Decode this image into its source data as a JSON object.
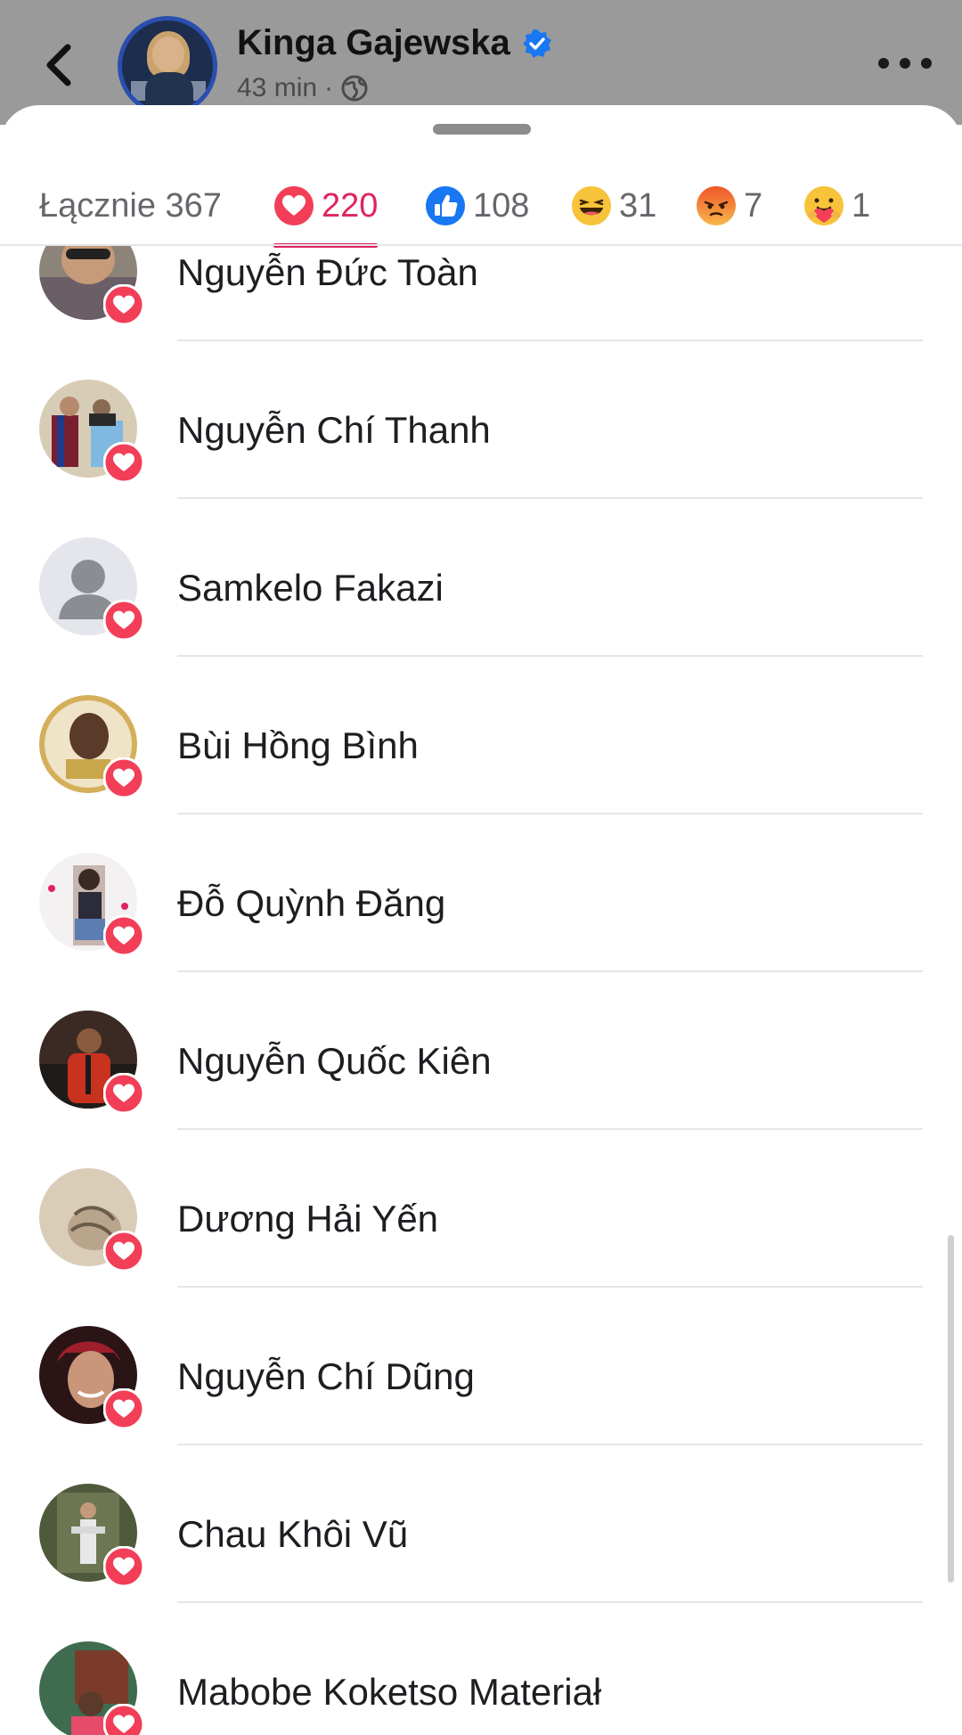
{
  "header": {
    "page_name": "Kinga Gajewska",
    "time": "43 min",
    "separator": "·",
    "icons": {
      "back": "back-chevron-icon",
      "verified": "verified-badge-icon",
      "privacy": "globe-icon",
      "more": "more-dots-icon"
    },
    "colors": {
      "verified": "#1877f2"
    }
  },
  "reaction_tabs": [
    {
      "label": "Łącznie 367",
      "icon": null
    },
    {
      "label": "220",
      "icon": "love-reaction-icon",
      "active": true
    },
    {
      "label": "108",
      "icon": "like-reaction-icon"
    },
    {
      "label": "31",
      "icon": "haha-reaction-icon"
    },
    {
      "label": "7",
      "icon": "angry-reaction-icon"
    },
    {
      "label": "1",
      "icon": "care-reaction-icon"
    }
  ],
  "reactors": [
    {
      "name": "Nguyễn Đức Toàn"
    },
    {
      "name": "Nguyễn Chí Thanh"
    },
    {
      "name": "Samkelo Fakazi"
    },
    {
      "name": "Bùi Hồng Bình"
    },
    {
      "name": "Đỗ Quỳnh Đăng"
    },
    {
      "name": "Nguyễn Quốc Kiên"
    },
    {
      "name": "Dương Hải Yến"
    },
    {
      "name": "Nguyễn Chí Dũng"
    },
    {
      "name": "Chau Khôi Vũ"
    },
    {
      "name": "Mabobe Koketso Materiał"
    }
  ],
  "colors": {
    "love": "#f33e58",
    "like": "#1877f2",
    "active_tab": "#e0245e"
  }
}
